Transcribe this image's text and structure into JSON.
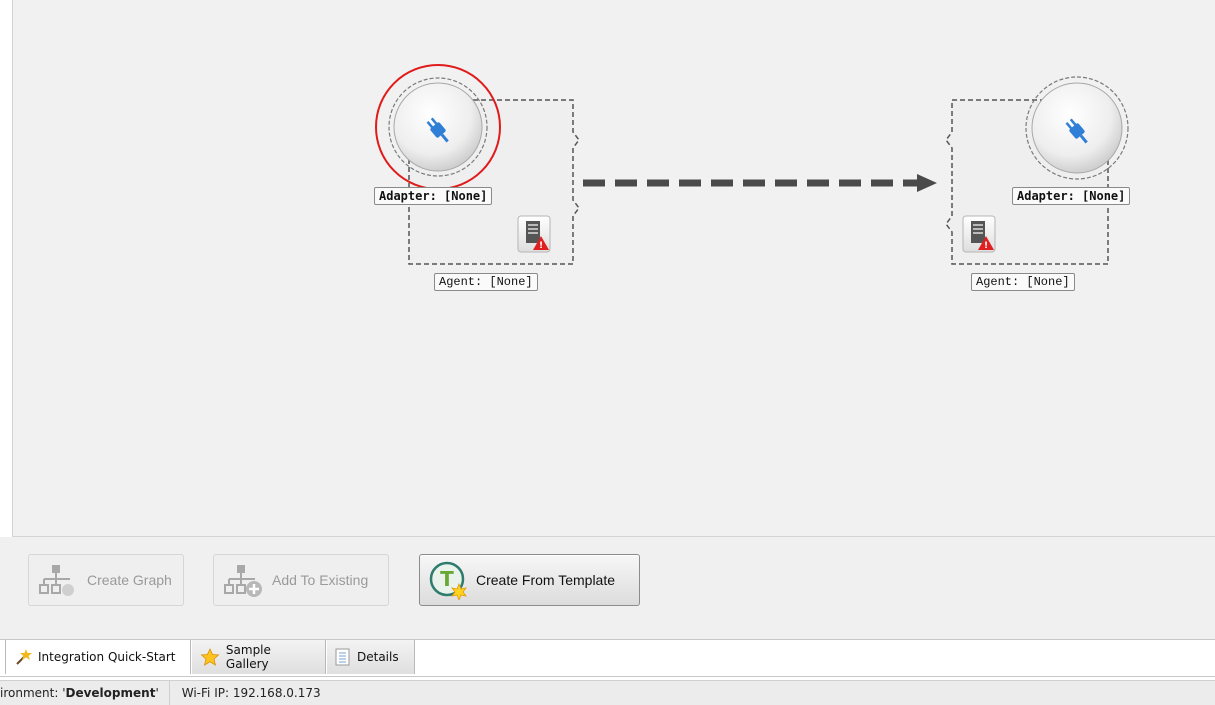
{
  "canvas": {
    "left_node": {
      "adapter_label": "Adapter: [None]",
      "agent_label": "Agent: [None]",
      "adapter_icon": "plug-icon",
      "agent_icon": "document-warning-icon",
      "highlighted": true,
      "highlight_color": "#e01b1b"
    },
    "right_node": {
      "adapter_label": "Adapter: [None]",
      "agent_label": "Agent: [None]",
      "adapter_icon": "plug-icon",
      "agent_icon": "document-warning-icon"
    },
    "connector": {
      "style": "dashed-arrow",
      "color": "#4a4a4a"
    }
  },
  "toolbar": {
    "create_graph_label": "Create Graph",
    "create_graph_enabled": false,
    "add_to_existing_label": "Add To Existing",
    "add_to_existing_enabled": false,
    "create_from_template_label": "Create From Template",
    "create_from_template_enabled": true
  },
  "tabs": [
    {
      "label": "Integration Quick-Start",
      "icon": "magic-wand-icon",
      "active": true
    },
    {
      "label": "Sample Gallery",
      "icon": "star-icon",
      "active": false
    },
    {
      "label": "Details",
      "icon": "list-document-icon",
      "active": false
    }
  ],
  "status": {
    "environment_prefix": "ironment: '",
    "environment_value": "Development",
    "environment_suffix": "'",
    "wifi_label": "Wi-Fi IP: 192.168.0.173"
  }
}
